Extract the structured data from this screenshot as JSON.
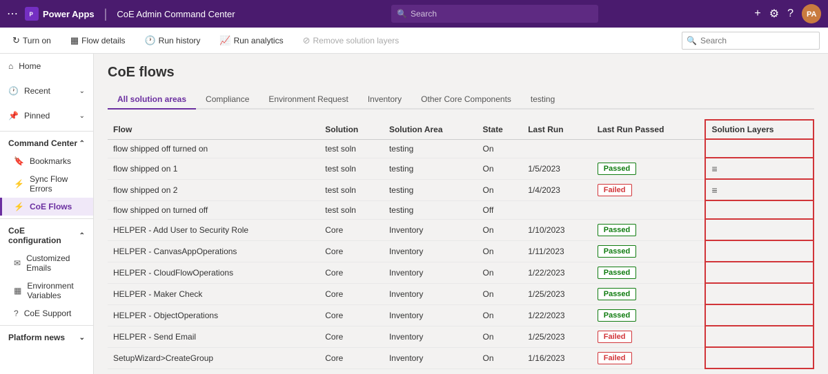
{
  "app": {
    "name": "Power Apps",
    "context": "CoE Admin Command Center"
  },
  "topbar": {
    "search_placeholder": "Search",
    "avatar_initials": "PA"
  },
  "subtoolbar": {
    "buttons": [
      {
        "id": "turn-on",
        "label": "Turn on",
        "icon": "↻",
        "disabled": false
      },
      {
        "id": "flow-details",
        "label": "Flow details",
        "icon": "⊞",
        "disabled": false
      },
      {
        "id": "run-history",
        "label": "Run history",
        "icon": "🕐",
        "disabled": false
      },
      {
        "id": "run-analytics",
        "label": "Run analytics",
        "icon": "📈",
        "disabled": false
      },
      {
        "id": "remove-solution-layers",
        "label": "Remove solution layers",
        "icon": "⊙",
        "disabled": true
      }
    ],
    "search_placeholder": "Search"
  },
  "sidebar": {
    "top_items": [
      {
        "id": "home",
        "label": "Home",
        "icon": "⌂"
      },
      {
        "id": "recent",
        "label": "Recent",
        "icon": "🕐",
        "expandable": true
      },
      {
        "id": "pinned",
        "label": "Pinned",
        "icon": "📌",
        "expandable": true
      }
    ],
    "sections": [
      {
        "id": "command-center",
        "label": "Command Center",
        "expanded": true,
        "items": [
          {
            "id": "bookmarks",
            "label": "Bookmarks",
            "icon": "🔖"
          },
          {
            "id": "sync-flow-errors",
            "label": "Sync Flow Errors",
            "icon": "⚡"
          },
          {
            "id": "coe-flows",
            "label": "CoE Flows",
            "icon": "⚡",
            "active": true
          }
        ]
      },
      {
        "id": "coe-configuration",
        "label": "CoE configuration",
        "expanded": true,
        "items": [
          {
            "id": "customized-emails",
            "label": "Customized Emails",
            "icon": "✉"
          },
          {
            "id": "environment-variables",
            "label": "Environment Variables",
            "icon": "⊞"
          },
          {
            "id": "coe-support",
            "label": "CoE Support",
            "icon": "?"
          }
        ]
      },
      {
        "id": "platform-news",
        "label": "Platform news",
        "expanded": false,
        "items": []
      }
    ]
  },
  "page": {
    "title": "CoE flows",
    "tabs": [
      {
        "id": "all",
        "label": "All solution areas",
        "active": true
      },
      {
        "id": "compliance",
        "label": "Compliance",
        "active": false
      },
      {
        "id": "environment-request",
        "label": "Environment Request",
        "active": false
      },
      {
        "id": "inventory",
        "label": "Inventory",
        "active": false
      },
      {
        "id": "other-core",
        "label": "Other Core Components",
        "active": false
      },
      {
        "id": "testing",
        "label": "testing",
        "active": false
      }
    ],
    "table": {
      "columns": [
        "Flow",
        "Solution",
        "Solution Area",
        "State",
        "Last Run",
        "Last Run Passed",
        "Solution Layers"
      ],
      "rows": [
        {
          "flow": "flow shipped off turned on",
          "solution": "test soln",
          "area": "testing",
          "state": "On",
          "last_run": "",
          "last_run_passed": "",
          "solution_layers": ""
        },
        {
          "flow": "flow shipped on 1",
          "solution": "test soln",
          "area": "testing",
          "state": "On",
          "last_run": "1/5/2023",
          "last_run_passed": "Passed",
          "solution_layers": "layers"
        },
        {
          "flow": "flow shipped on 2",
          "solution": "test soln",
          "area": "testing",
          "state": "On",
          "last_run": "1/4/2023",
          "last_run_passed": "Failed",
          "solution_layers": "layers"
        },
        {
          "flow": "flow shipped on turned off",
          "solution": "test soln",
          "area": "testing",
          "state": "Off",
          "last_run": "",
          "last_run_passed": "",
          "solution_layers": ""
        },
        {
          "flow": "HELPER - Add User to Security Role",
          "solution": "Core",
          "area": "Inventory",
          "state": "On",
          "last_run": "1/10/2023",
          "last_run_passed": "Passed",
          "solution_layers": ""
        },
        {
          "flow": "HELPER - CanvasAppOperations",
          "solution": "Core",
          "area": "Inventory",
          "state": "On",
          "last_run": "1/11/2023",
          "last_run_passed": "Passed",
          "solution_layers": ""
        },
        {
          "flow": "HELPER - CloudFlowOperations",
          "solution": "Core",
          "area": "Inventory",
          "state": "On",
          "last_run": "1/22/2023",
          "last_run_passed": "Passed",
          "solution_layers": ""
        },
        {
          "flow": "HELPER - Maker Check",
          "solution": "Core",
          "area": "Inventory",
          "state": "On",
          "last_run": "1/25/2023",
          "last_run_passed": "Passed",
          "solution_layers": ""
        },
        {
          "flow": "HELPER - ObjectOperations",
          "solution": "Core",
          "area": "Inventory",
          "state": "On",
          "last_run": "1/22/2023",
          "last_run_passed": "Passed",
          "solution_layers": ""
        },
        {
          "flow": "HELPER - Send Email",
          "solution": "Core",
          "area": "Inventory",
          "state": "On",
          "last_run": "1/25/2023",
          "last_run_passed": "Failed",
          "solution_layers": ""
        },
        {
          "flow": "SetupWizard>CreateGroup",
          "solution": "Core",
          "area": "Inventory",
          "state": "On",
          "last_run": "1/16/2023",
          "last_run_passed": "Failed",
          "solution_layers": ""
        }
      ]
    }
  },
  "colors": {
    "brand_purple": "#4a1b6e",
    "accent_purple": "#6b2fa0",
    "passed_green": "#107c10",
    "failed_red": "#d13438"
  }
}
